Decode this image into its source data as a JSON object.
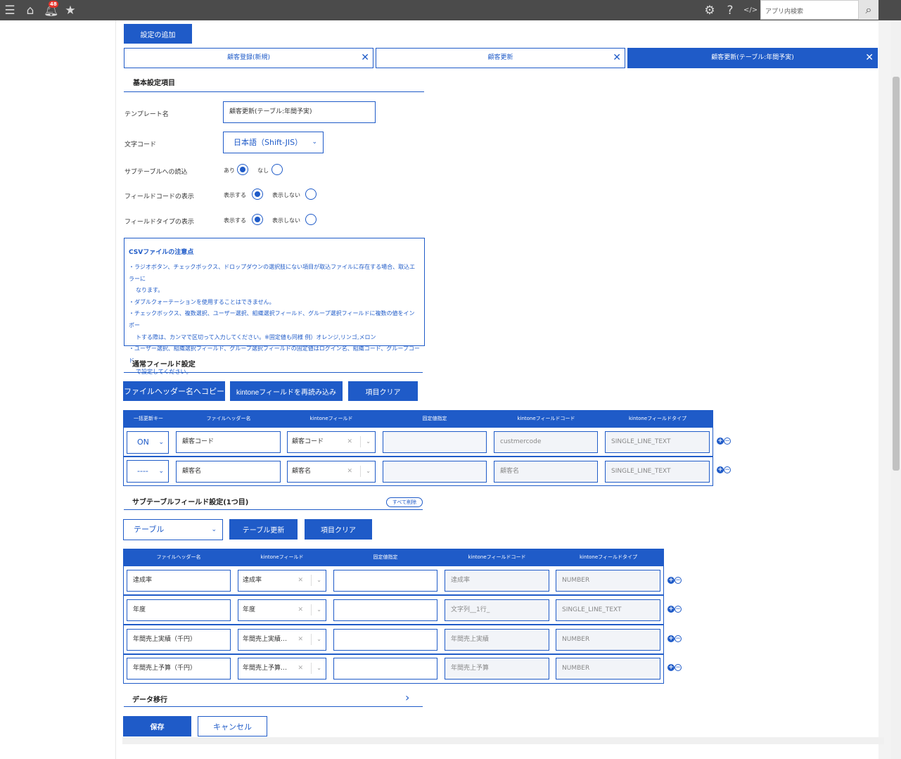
{
  "topbar": {
    "notification_count": "48",
    "search_placeholder": "アプリ内検索"
  },
  "actions": {
    "add_setting": "設定の追加"
  },
  "tabs": [
    {
      "label": "顧客登録(新規)",
      "active": false
    },
    {
      "label": "顧客更新",
      "active": false
    },
    {
      "label": "顧客更新(テーブル:年間予実)",
      "active": true
    }
  ],
  "basic": {
    "title": "基本設定項目",
    "template_name_label": "テンプレート名",
    "template_name_value": "顧客更新(テーブル:年間予実)",
    "charset_label": "文字コード",
    "charset_value": "日本語（Shift-JIS）",
    "subtable_label": "サブテーブルへの読込",
    "subtable_yes": "あり",
    "subtable_no": "なし",
    "fieldcode_label": "フィールドコードの表示",
    "fieldcode_show": "表示する",
    "fieldcode_hide": "表示しない",
    "fieldtype_label": "フィールドタイプの表示",
    "fieldtype_show": "表示する",
    "fieldtype_hide": "表示しない"
  },
  "notice": {
    "title": "CSVファイルの注意点",
    "lines": [
      "・ラジオボタン、チェックボックス、ドロップダウンの選択肢にない項目が取込ファイルに存在する場合、取込エラーに",
      "なります。",
      "・ダブルクォーテーションを使用することはできません。",
      "・チェックボックス、複数選択、ユーザー選択、組織選択フィールド、グループ選択フィールドに複数の値をインポー",
      "トする際は、カンマで区切って入力してください。※固定値も同様 例）オレンジ,リンゴ,メロン",
      "・ユーザー選択、組織選択フィールド、グループ選択フィールドの固定値はログイン名、組織コード、グループコード",
      "で設定してください。"
    ]
  },
  "normal": {
    "title": "通常フィールド設定",
    "btn_copy": "ファイルヘッダー名へコピー",
    "btn_reload": "kintoneフィールドを再読み込み",
    "btn_clear": "項目クリア",
    "headers": [
      "一括更新キー",
      "ファイルヘッダー名",
      "kintoneフィールド",
      "固定値指定",
      "kintoneフィールドコード",
      "kintoneフィールドタイプ"
    ],
    "rows": [
      {
        "key": "ON",
        "header": "顧客コード",
        "field": "顧客コード",
        "fixed": "",
        "code": "custmercode",
        "type": "SINGLE_LINE_TEXT"
      },
      {
        "key": "----",
        "header": "顧客名",
        "field": "顧客名",
        "fixed": "",
        "code": "顧客名",
        "type": "SINGLE_LINE_TEXT"
      }
    ]
  },
  "subtable": {
    "title": "サブテーブルフィールド設定(1つ目)",
    "delete_all": "すべて削除",
    "table_select": "テーブル",
    "btn_update": "テーブル更新",
    "btn_clear": "項目クリア",
    "headers": [
      "ファイルヘッダー名",
      "kintoneフィールド",
      "固定値指定",
      "kintoneフィールドコード",
      "kintoneフィールドタイプ"
    ],
    "rows": [
      {
        "header": "達成率",
        "field": "達成率",
        "fixed": "",
        "code": "達成率",
        "type": "NUMBER"
      },
      {
        "header": "年度",
        "field": "年度",
        "fixed": "",
        "code": "文字列__1行_",
        "type": "SINGLE_LINE_TEXT"
      },
      {
        "header": "年間売上実績（千円）",
        "field": "年間売上実績…",
        "fixed": "",
        "code": "年間売上実績",
        "type": "NUMBER"
      },
      {
        "header": "年間売上予算（千円）",
        "field": "年間売上予算…",
        "fixed": "",
        "code": "年間売上予算",
        "type": "NUMBER"
      }
    ]
  },
  "migration": {
    "title": "データ移行"
  },
  "footer": {
    "save": "保存",
    "cancel": "キャンセル"
  },
  "icons": {
    "menu": "menu-icon",
    "home": "home-icon",
    "bell": "bell-icon",
    "star": "star-icon",
    "gear": "gear-icon",
    "help": "help-icon",
    "dev": "code-icon",
    "search": "search-icon"
  },
  "colors": {
    "accent": "#1f5bc8",
    "topbar": "#4b4b4b",
    "badge": "#e5352c"
  }
}
